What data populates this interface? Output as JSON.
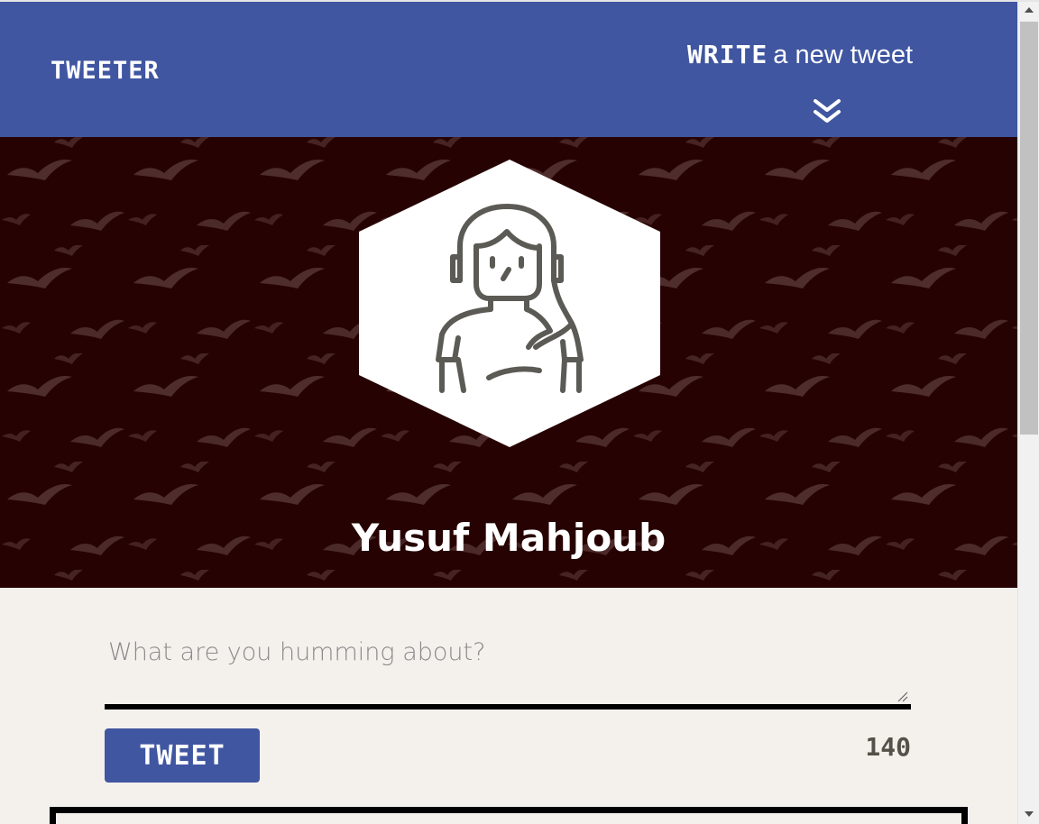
{
  "nav": {
    "brand": "TWEETER",
    "write_bold": "WRITE",
    "write_rest": "a new tweet",
    "toggle_icon": "double-chevron-down-icon"
  },
  "header": {
    "user_name": "Yusuf Mahjoub",
    "avatar_icon": "user-avatar-icon",
    "background_color": "#270202"
  },
  "compose": {
    "placeholder": "What are you humming about?",
    "value": "",
    "button_label": "TWEET",
    "counter": "140"
  },
  "colors": {
    "accent": "#4056a1",
    "page_background": "#f4f1ed"
  }
}
